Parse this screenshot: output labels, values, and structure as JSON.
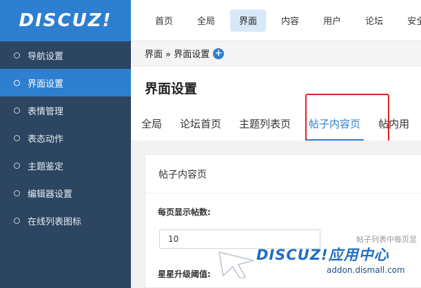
{
  "logo": "DISCUZ!",
  "sidebar": {
    "items": [
      {
        "label": "导航设置"
      },
      {
        "label": "界面设置"
      },
      {
        "label": "表情管理"
      },
      {
        "label": "表态动作"
      },
      {
        "label": "主题鉴定"
      },
      {
        "label": "编辑器设置"
      },
      {
        "label": "在线列表图标"
      }
    ],
    "active_index": 1
  },
  "topnav": {
    "items": [
      {
        "label": "首页"
      },
      {
        "label": "全局"
      },
      {
        "label": "界面"
      },
      {
        "label": "内容"
      },
      {
        "label": "用户"
      },
      {
        "label": "论坛"
      },
      {
        "label": "安全"
      }
    ],
    "active_index": 2
  },
  "breadcrumb": {
    "text": "界面 » 界面设置",
    "add_symbol": "+"
  },
  "page": {
    "title": "界面设置"
  },
  "tabs": {
    "items": [
      {
        "label": "全局"
      },
      {
        "label": "论坛首页"
      },
      {
        "label": "主题列表页"
      },
      {
        "label": "帖子内容页"
      },
      {
        "label": "帖内用"
      }
    ],
    "active_index": 3
  },
  "card": {
    "header": "帖子内容页",
    "field1_label": "每页显示帖数:",
    "field1_value": "10",
    "field1_hint": "帖子列表中每页显",
    "field2_label": "星星升级阈值:"
  },
  "watermark": {
    "title": "DISCUZ!应用中心",
    "url": "addon.dismall.com"
  },
  "colors": {
    "accent": "#2e7fcf",
    "sidebar_bg": "#2c4560",
    "highlight": "#e02020"
  }
}
